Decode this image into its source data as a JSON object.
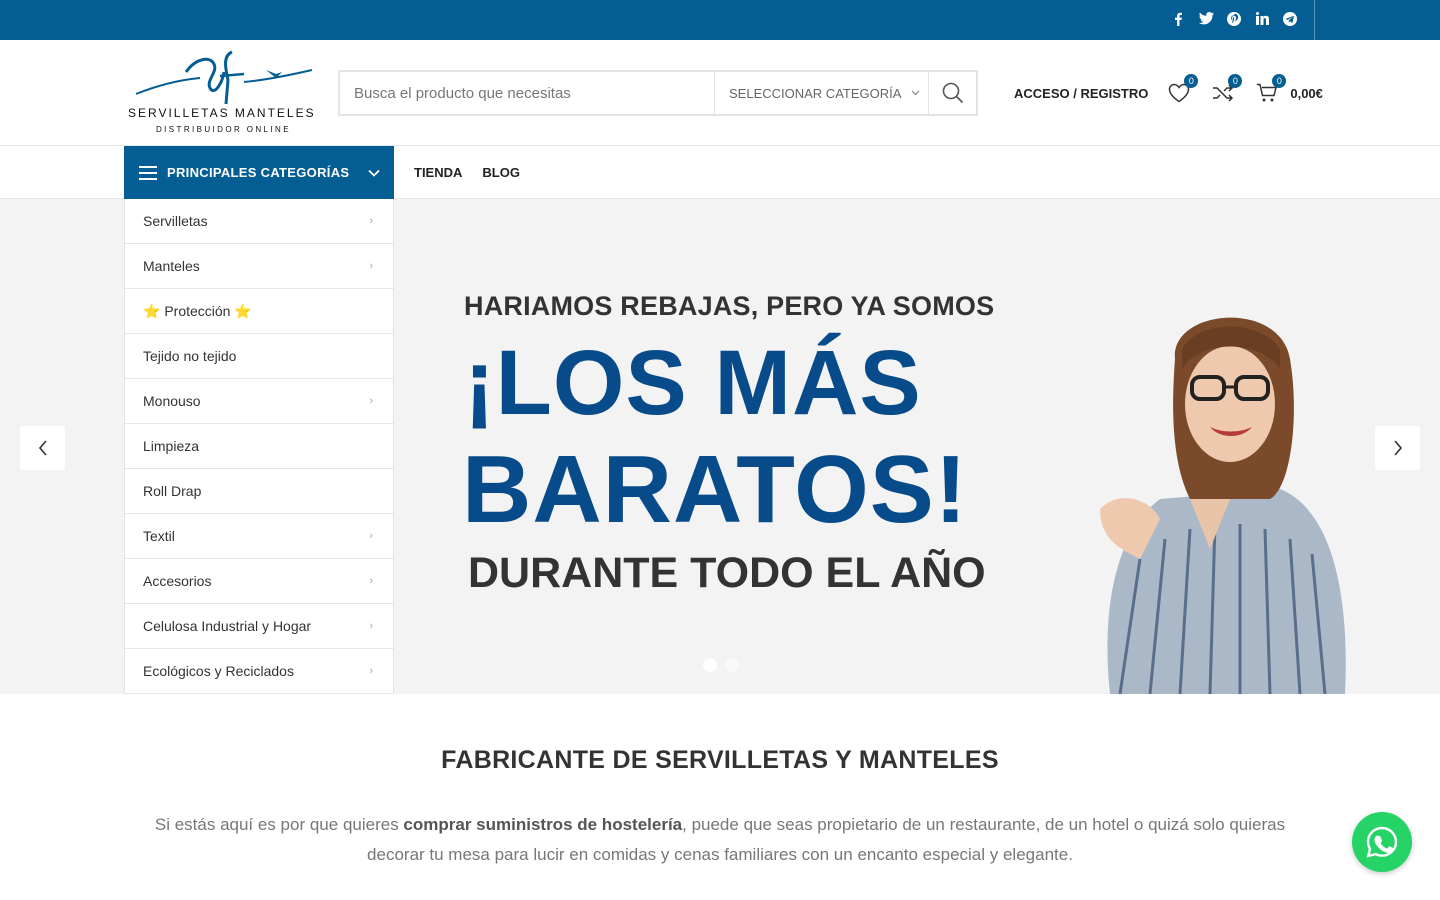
{
  "topbar": {
    "social": [
      "f",
      "t",
      "p",
      "in",
      "tg"
    ],
    "color": "#045e93"
  },
  "logo": {
    "line1": "SERVILLETAS MANTELES",
    "line2": "DISTRIBUIDOR ONLINE"
  },
  "search": {
    "placeholder": "Busca el producto que necesitas",
    "category": "SELECCIONAR CATEGORÍA"
  },
  "header": {
    "account": "ACCESO / REGISTRO",
    "wishlist_count": "0",
    "compare_count": "0",
    "cart_count": "0",
    "cart_total": "0,00€"
  },
  "nav": {
    "categories_label": "PRINCIPALES CATEGORÍAS",
    "links": [
      "TIENDA",
      "BLOG"
    ]
  },
  "categories": [
    {
      "label": "Servilletas",
      "arrow": true
    },
    {
      "label": "Manteles",
      "arrow": true
    },
    {
      "label": "⭐ Protección ⭐",
      "arrow": false
    },
    {
      "label": "Tejido no tejido",
      "arrow": false
    },
    {
      "label": "Monouso",
      "arrow": true
    },
    {
      "label": "Limpieza",
      "arrow": false
    },
    {
      "label": "Roll Drap",
      "arrow": false
    },
    {
      "label": "Textil",
      "arrow": true
    },
    {
      "label": "Accesorios",
      "arrow": true
    },
    {
      "label": "Celulosa Industrial y Hogar",
      "arrow": true
    },
    {
      "label": "Ecológicos y Reciclados",
      "arrow": true
    }
  ],
  "hero": {
    "line1": "HARIAMOS REBAJAS, PERO YA SOMOS",
    "line2": "¡LOS MÁS",
    "line3": "BARATOS!",
    "line4": "DURANTE TODO EL AÑO",
    "slides": 2,
    "active_slide": 1
  },
  "section": {
    "title": "FABRICANTE DE SERVILLETAS Y MANTELES",
    "para_before": "Si estás aquí es por que quieres ",
    "para_bold": "comprar suministros de hostelería",
    "para_after": ", puede que seas propietario de un restaurante, de un hotel o quizá solo quieras decorar tu mesa para lucir en comidas y cenas familiares con un encanto especial y elegante."
  },
  "colors": {
    "brand": "#045e93",
    "headline": "#084b8a",
    "whatsapp": "#25d366"
  }
}
